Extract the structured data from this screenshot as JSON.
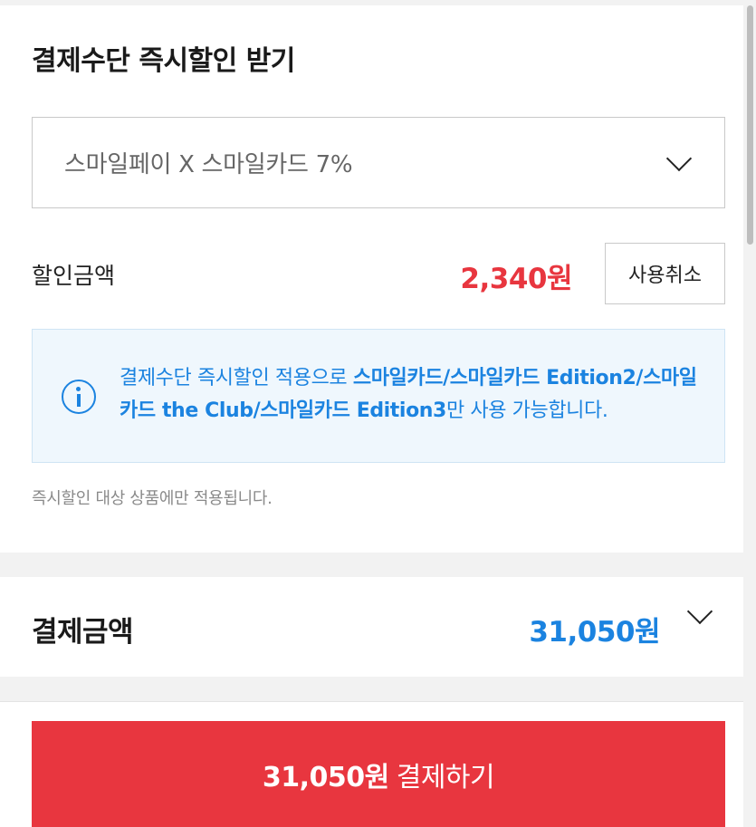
{
  "discount_section": {
    "title": "결제수단 즉시할인 받기",
    "selected_method": "스마일페이 X 스마일카드 7%",
    "discount_label": "할인금액",
    "discount_amount": "2,340원",
    "cancel_label": "사용취소"
  },
  "notice": {
    "text_normal_1": "결제수단 즉시할인 적용으로 ",
    "text_bold": "스마일카드/스마일카드 Edition2/스마일카드 the Club/스마일카드 Edition3",
    "text_normal_2": "만 사용 가능합니다.",
    "icon": "info-icon",
    "color": "#1b83e0"
  },
  "footnote": "즉시할인 대상 상품에만 적용됩니다.",
  "total": {
    "label": "결제금액",
    "amount": "31,050원"
  },
  "pay_button": {
    "amount": "31,050원",
    "label": "결제하기"
  },
  "colors": {
    "accent_red": "#e8363f",
    "accent_blue": "#1b83e0"
  }
}
